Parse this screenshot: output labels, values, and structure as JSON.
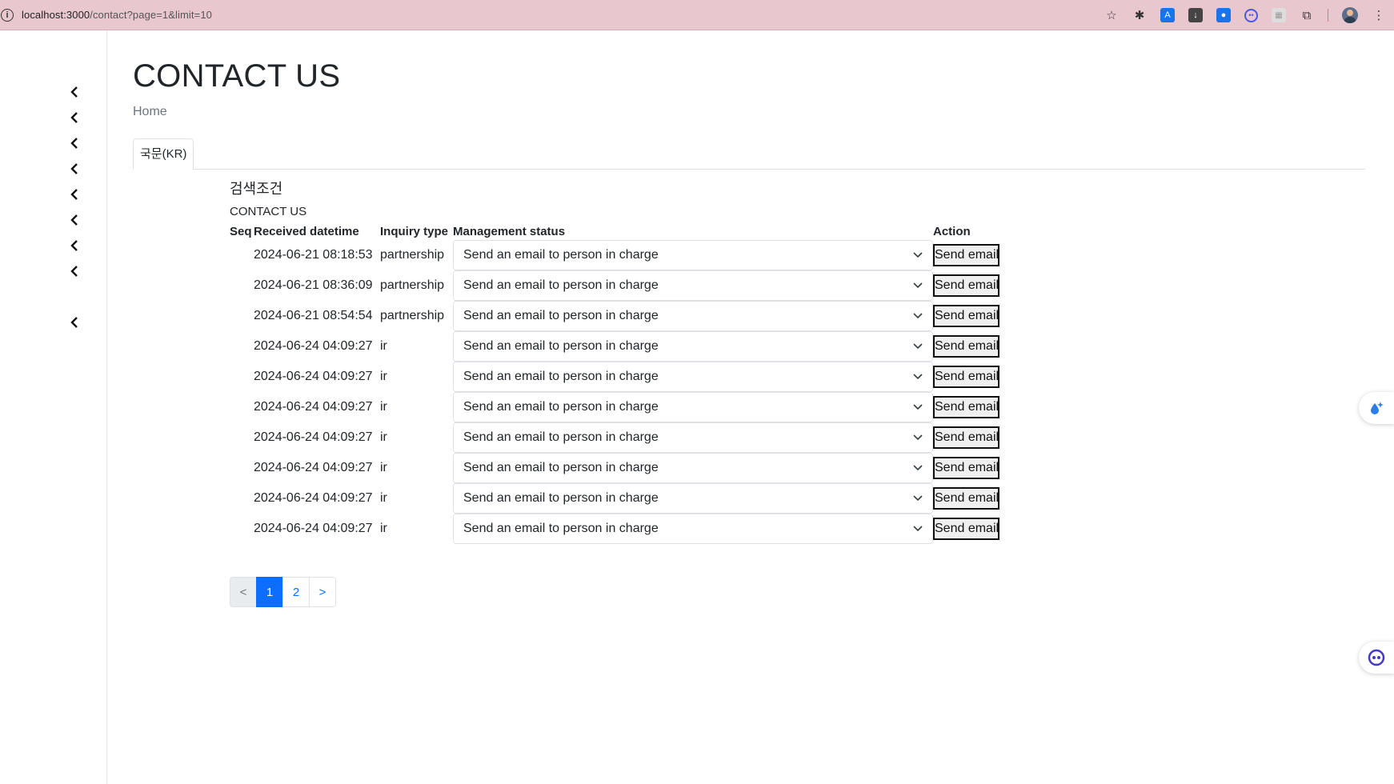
{
  "browser": {
    "url_host": "localhost:3000",
    "url_path": "/contact?page=1&limit=10"
  },
  "page": {
    "title": "CONTACT US",
    "breadcrumb": "Home",
    "tab_label": "국문(KR)",
    "search_title": "검색조건",
    "section_label": "CONTACT US"
  },
  "table": {
    "headers": {
      "seq": "Seq",
      "received": "Received datetime",
      "inquiry": "Inquiry type",
      "status": "Management status",
      "action": "Action"
    },
    "rows": [
      {
        "datetime": "2024-06-21 08:18:53",
        "type": "partnership",
        "status": "Send an email to person in charge",
        "action": "Send email"
      },
      {
        "datetime": "2024-06-21 08:36:09",
        "type": "partnership",
        "status": "Send an email to person in charge",
        "action": "Send email"
      },
      {
        "datetime": "2024-06-21 08:54:54",
        "type": "partnership",
        "status": "Send an email to person in charge",
        "action": "Send email"
      },
      {
        "datetime": "2024-06-24 04:09:27",
        "type": "ir",
        "status": "Send an email to person in charge",
        "action": "Send email"
      },
      {
        "datetime": "2024-06-24 04:09:27",
        "type": "ir",
        "status": "Send an email to person in charge",
        "action": "Send email"
      },
      {
        "datetime": "2024-06-24 04:09:27",
        "type": "ir",
        "status": "Send an email to person in charge",
        "action": "Send email"
      },
      {
        "datetime": "2024-06-24 04:09:27",
        "type": "ir",
        "status": "Send an email to person in charge",
        "action": "Send email"
      },
      {
        "datetime": "2024-06-24 04:09:27",
        "type": "ir",
        "status": "Send an email to person in charge",
        "action": "Send email"
      },
      {
        "datetime": "2024-06-24 04:09:27",
        "type": "ir",
        "status": "Send an email to person in charge",
        "action": "Send email"
      },
      {
        "datetime": "2024-06-24 04:09:27",
        "type": "ir",
        "status": "Send an email to person in charge",
        "action": "Send email"
      }
    ]
  },
  "pagination": {
    "prev": "<",
    "pages": [
      "1",
      "2"
    ],
    "current": "1",
    "next": ">"
  },
  "sidebar": {
    "icons": [
      "chevron-left-icon",
      "chevron-left-icon",
      "chevron-left-icon",
      "chevron-left-icon",
      "chevron-left-icon",
      "chevron-left-icon",
      "chevron-left-icon",
      "chevron-left-icon",
      "chevron-left-icon"
    ]
  },
  "colors": {
    "browser_bar": "#e8c7cf",
    "primary": "#0d6efd",
    "border": "#dee2e6",
    "muted": "#6c757d"
  }
}
